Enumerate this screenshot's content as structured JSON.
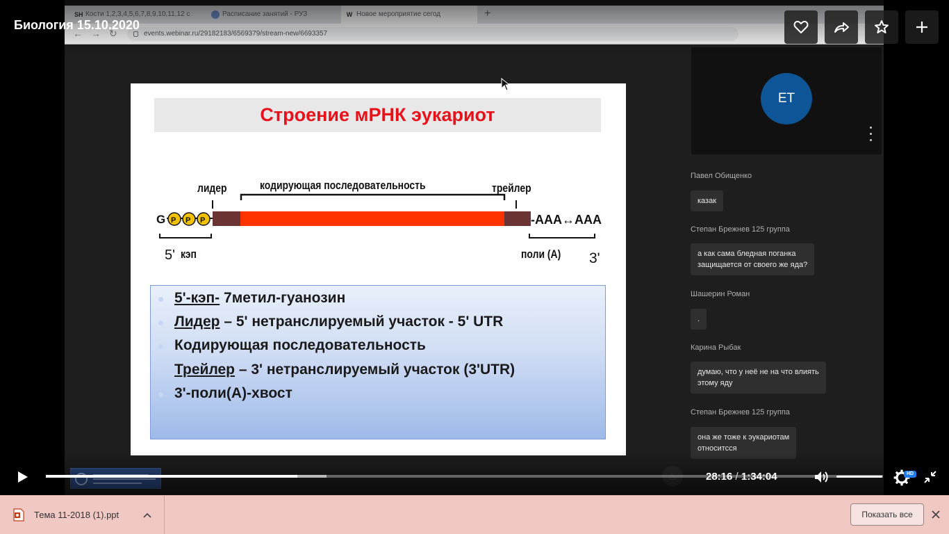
{
  "player": {
    "title": "Биология 15.10.2020",
    "current_time": "28:16",
    "time_separator": "/",
    "duration": "1:34:04",
    "played_fraction": 0.3,
    "buffered_fraction": 0.335,
    "quality_badge": "HD"
  },
  "recorded_browser": {
    "tabs": [
      {
        "favicon": "SH",
        "title": "Кости 1,2,3,4,5,6,7,8,9,10,11,12 с"
      },
      {
        "favicon": "",
        "title": "Расписание занятий - РУЗ"
      },
      {
        "favicon": "W",
        "title": "Новое мероприятие сегод"
      }
    ],
    "url": "events.webinar.ru/29182183/6569379/stream-new/6693357"
  },
  "slide": {
    "title": "Строение мРНК эукариот",
    "diagram": {
      "leader": "лидер",
      "coding": "кодирующая последовательность",
      "trailer": "трейлер",
      "cap_prefix": "5'",
      "cap": "кэп",
      "poly": "поли (А)",
      "three_prime": "3'",
      "g": "G",
      "p": "P",
      "tail": "-AAA↔AAA"
    },
    "bullets": [
      {
        "term": "5'-кэп-",
        "rest": " 7метил-гуанозин"
      },
      {
        "term": "Лидер",
        "rest": " – 5' нетранслируемый участок - 5' UTR"
      },
      {
        "term": "",
        "rest": "Кодирующая последовательность"
      },
      {
        "term": "Трейлер",
        "rest": " – 3' нетранслируемый участок (3'UTR)"
      },
      {
        "term": "",
        "rest": "3'-поли(А)-хвост"
      }
    ]
  },
  "webinar": {
    "avatar_initials": "ЕТ",
    "chat": [
      {
        "author": "Павел Обищенко",
        "text": [
          "казак"
        ]
      },
      {
        "author": "Степан Брежнев 125 группа",
        "text": [
          "а как сама бледная поганка",
          "защищается от своего же яда?"
        ]
      },
      {
        "author": "Шашерин Роман",
        "text": [
          "."
        ]
      },
      {
        "author": "Карина Рыбак",
        "text": [
          "думаю, что у неё не на что влиять",
          "этому яду"
        ]
      },
      {
        "author": "Степан Брежнев 125 группа",
        "text": [
          "она же тоже к эукариотам",
          "относитсся"
        ]
      }
    ]
  },
  "downloads": {
    "file_name": "Тема 11-2018 (1).ppt",
    "show_all": "Показать все"
  },
  "colors": {
    "slide_title": "#e8111a",
    "coding_bar": "#ff3300",
    "utr_bar": "#6b3434",
    "cap_p": "#f2c200",
    "avatar": "#0d5596",
    "download_bar": "#f0c8c4",
    "hd_badge": "#1f7bf2"
  }
}
